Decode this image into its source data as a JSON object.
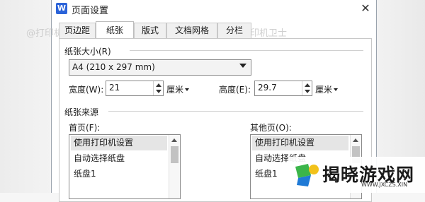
{
  "window": {
    "app_icon_letter": "W",
    "title": "页面设置",
    "close_glyph": "✕"
  },
  "tabs": [
    "页边距",
    "纸张",
    "版式",
    "文档网格",
    "分栏"
  ],
  "active_tab": "纸张",
  "paper_size": {
    "section_label": "纸张大小(R)",
    "selected": "A4 (210 x 297 mm)",
    "width_label": "宽度(W):",
    "width_value": "21",
    "width_unit": "厘米",
    "height_label": "高度(E):",
    "height_value": "29.7",
    "height_unit": "厘米"
  },
  "paper_source": {
    "section_label": "纸张来源",
    "first_page_label": "首页(F):",
    "first_page_items": [
      "使用打印机设置",
      "自动选择纸盘",
      "纸盘1"
    ],
    "other_pages_label": "其他页(O):",
    "other_pages_items": [
      "使用打印机设置",
      "自动选择纸盘",
      "纸盘1"
    ]
  },
  "watermark_text": "@打印机卫士",
  "logo": {
    "name": "揭晓游戏网",
    "domain": "WWW.JXCZS.XIN"
  },
  "colors": {
    "accent": "#2b63d9",
    "logo_green": "#3bb54a",
    "logo_blue": "#1f7ad6",
    "logo_yellow": "#f2c21b"
  }
}
